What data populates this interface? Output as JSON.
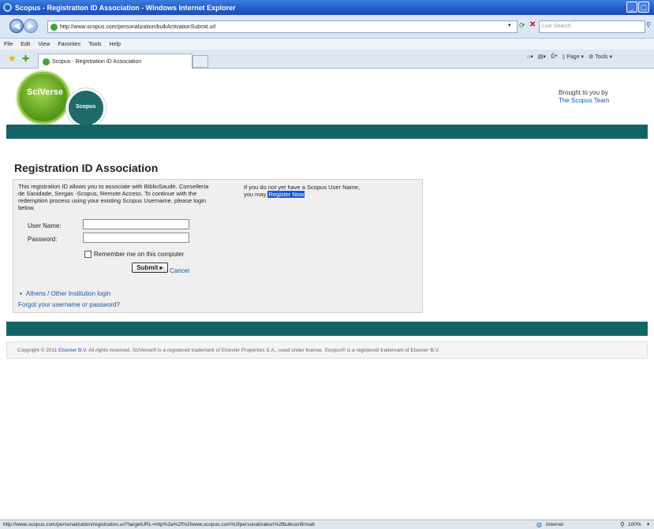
{
  "window": {
    "title": "Scopus - Registration ID Association - Windows Internet Explorer"
  },
  "address_bar": {
    "url": "http://www.scopus.com/personalization/bulkActivationSubmit.url",
    "search_placeholder": "Live Search"
  },
  "menu": [
    "File",
    "Edit",
    "View",
    "Favorites",
    "Tools",
    "Help"
  ],
  "tab": {
    "label": "Scopus - Registration ID Association"
  },
  "command_bar": {
    "page": "Page",
    "tools": "Tools"
  },
  "logos": {
    "sciverse": "SciVerse",
    "scopus": "Scopus"
  },
  "brought": {
    "line1": "Brought to you by",
    "team": "The Scopus Team"
  },
  "page": {
    "title": "Registration ID Association",
    "intro": "This registration ID allows you to associate with BiblioSaude. Conselleria de Sanidade, Sergas -Scopus, Remote Access. To continue with the redemption process using your existing Scopus Username, please login below.",
    "noacct_1": "If you do not yet have a Scopus User Name,",
    "noacct_2": "you may",
    "register": "Register Now",
    "username_label": "User Name:",
    "password_label": "Password:",
    "remember": "Remember me on this computer",
    "submit": "Submit",
    "cancel": "Cancel",
    "athens": "Athens / Other Institution login",
    "forgot": "Forgot your username or password?"
  },
  "footer": {
    "pre": "Copyright © 2011",
    "elsevier": "Elsevier B.V.",
    "post": "All rights reserved. SciVerse® is a registered trademark of Elsevier Properties S.A., used under license. Scopus® is a registered trademark of Elsevier B.V."
  },
  "status": {
    "url": "http://www.scopus.com/personalization/registration.url?targetURL=http%3a%2f%2fwww.scopus.com%2fpersonalization%2fbulkconfirmati",
    "zone": "Internet",
    "zoom": "100%"
  },
  "colors": {
    "teal": "#136565",
    "link": "#1b57a6",
    "sciverse_green": "#5a9e1e"
  }
}
